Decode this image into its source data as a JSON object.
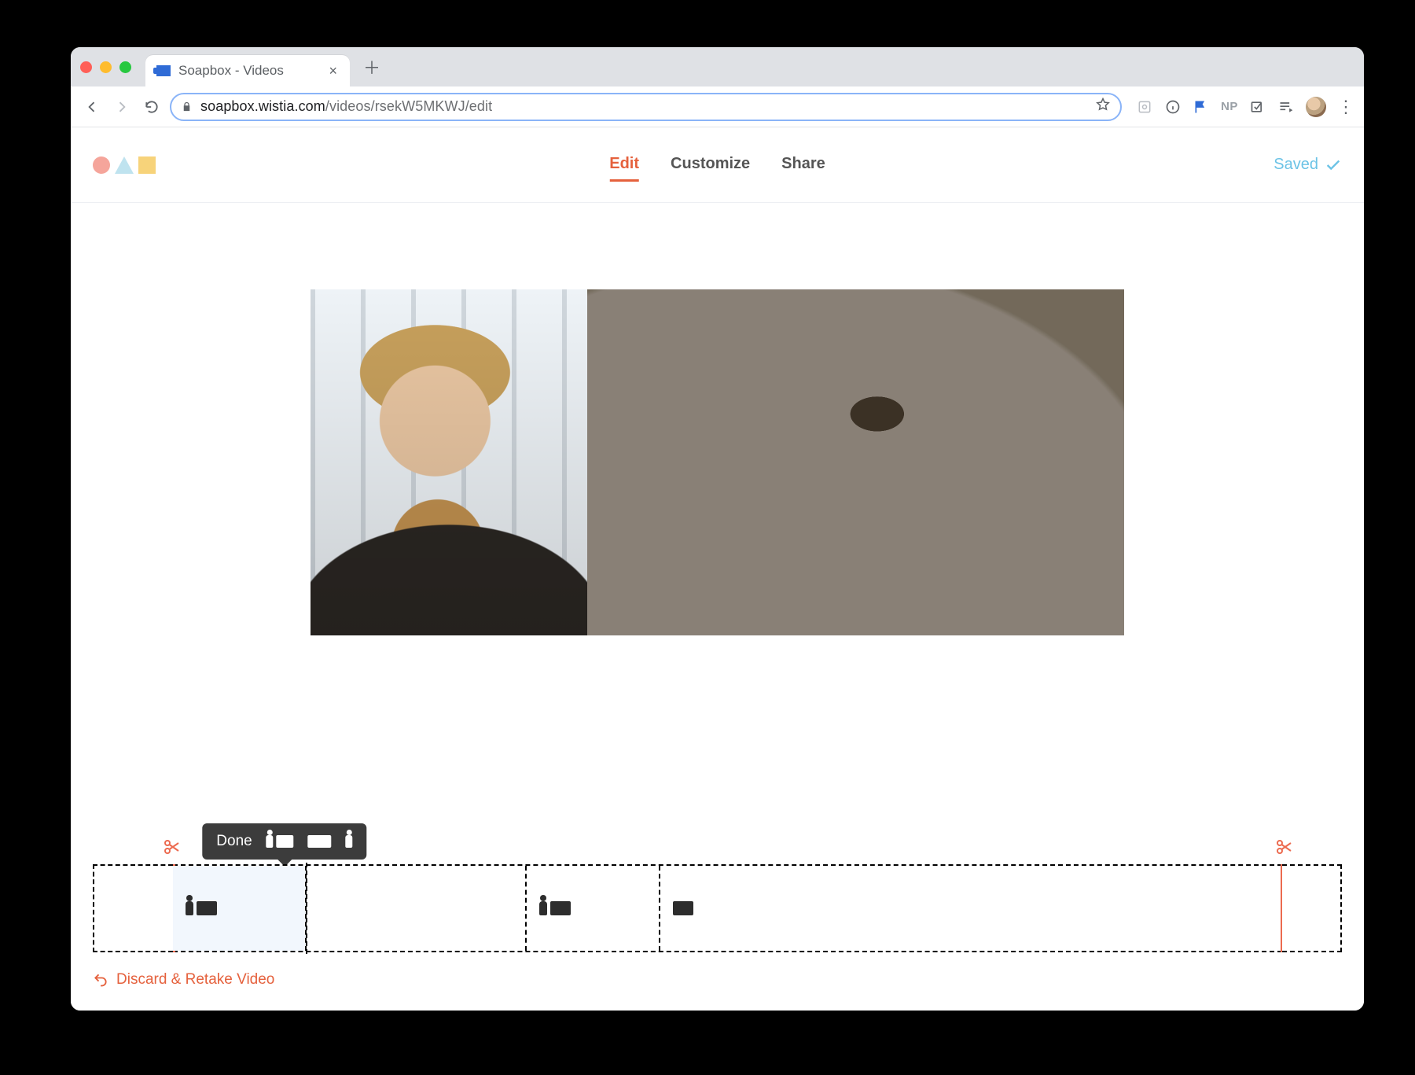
{
  "browser": {
    "tab_title": "Soapbox - Videos",
    "url_host": "soapbox.wistia.com",
    "url_path": "/videos/rsekW5MKWJ/edit",
    "extensions": {
      "np_label": "NP"
    }
  },
  "header": {
    "tabs": {
      "edit": "Edit",
      "customize": "Customize",
      "share": "Share"
    },
    "saved_label": "Saved"
  },
  "tooltip": {
    "done_label": "Done"
  },
  "footer": {
    "discard_label": "Discard & Retake Video"
  }
}
